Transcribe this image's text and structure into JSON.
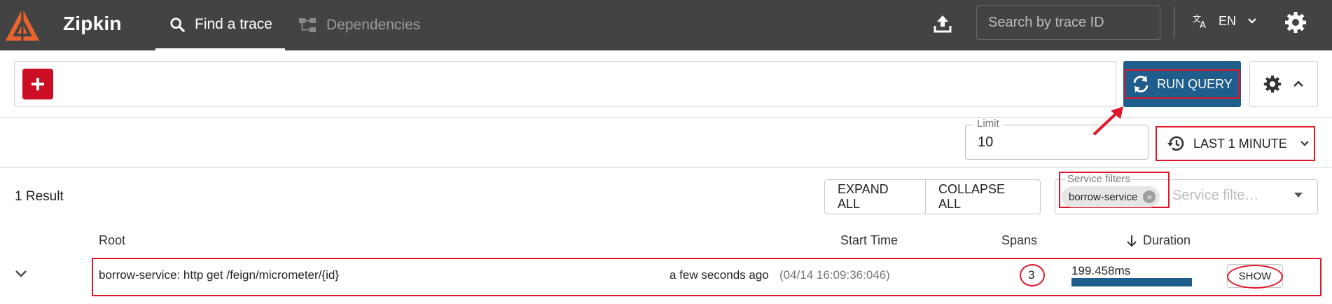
{
  "header": {
    "brand": "Zipkin",
    "tabs": [
      {
        "label": "Find a trace",
        "active": true,
        "icon": "search-icon"
      },
      {
        "label": "Dependencies",
        "active": false,
        "icon": "dependencies-icon"
      }
    ],
    "search_placeholder": "Search by trace ID",
    "language": "EN"
  },
  "query": {
    "run_label": "RUN QUERY",
    "limit_label": "Limit",
    "limit_value": "10",
    "time_range": "LAST 1 MINUTE"
  },
  "results": {
    "count_label": "1 Result",
    "expand_all": "EXPAND ALL",
    "collapse_all": "COLLAPSE ALL",
    "service_filters": {
      "label": "Service filters",
      "chips": [
        "borrow-service"
      ],
      "placeholder": "Service filte…"
    },
    "columns": {
      "root": "Root",
      "start_time": "Start Time",
      "spans": "Spans",
      "duration": "Duration"
    },
    "rows": [
      {
        "root": "borrow-service: http get /feign/micrometer/{id}",
        "relative_time": "a few seconds ago",
        "absolute_time": "(04/14 16:09:36:046)",
        "spans": "3",
        "duration": "199.458ms",
        "duration_fraction": 1.0,
        "show_label": "SHOW"
      }
    ]
  },
  "colors": {
    "header_bg": "#434343",
    "brand_orange": "#e8642c",
    "accent_blue": "#1f5d8c",
    "add_red": "#cc0e25",
    "annotation_red": "#e0162b"
  }
}
